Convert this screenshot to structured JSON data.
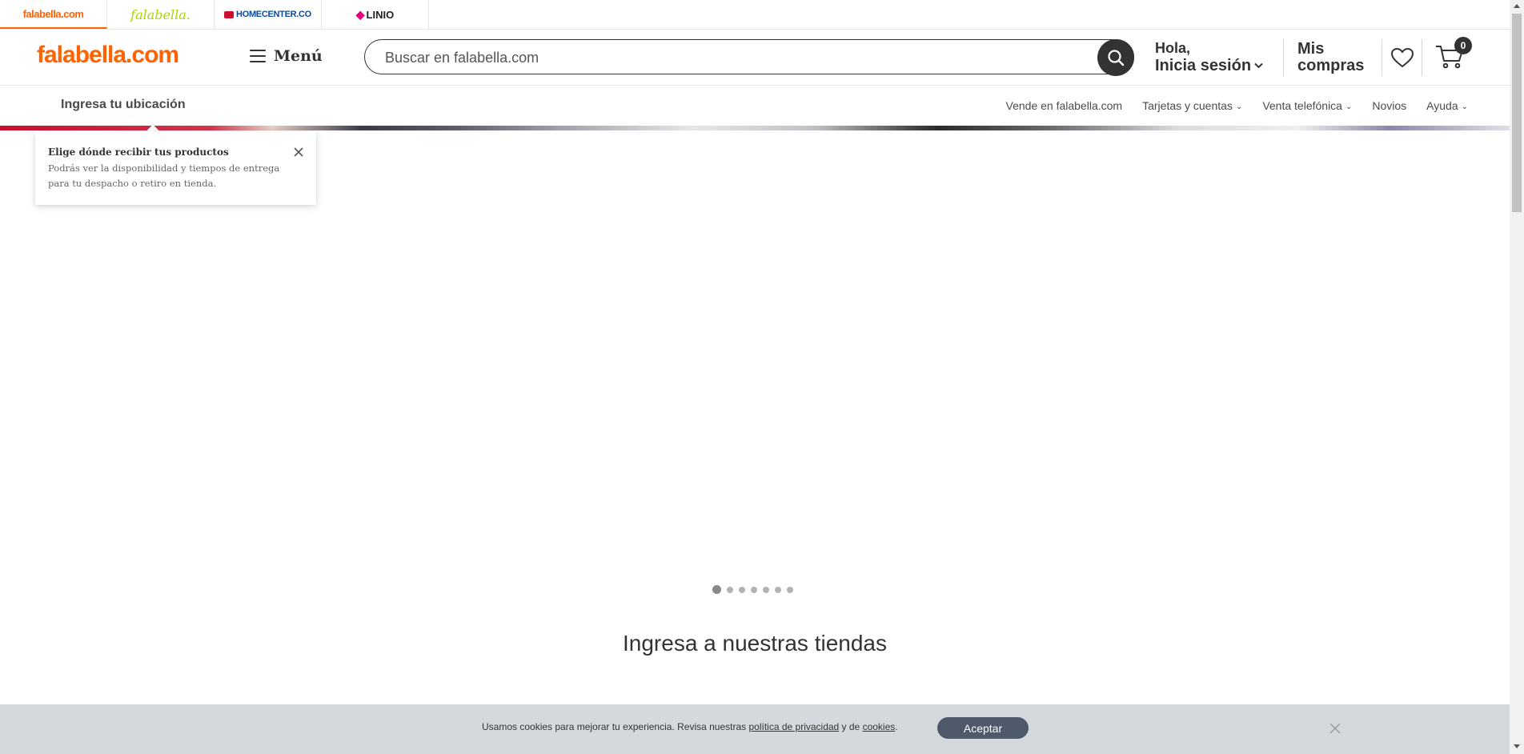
{
  "brand_tabs": [
    {
      "label": "falabella.com",
      "active": true
    },
    {
      "label": "falabella.",
      "active": false
    },
    {
      "label": "HOMECENTER.CO",
      "active": false
    },
    {
      "label": "LINIO",
      "active": false
    }
  ],
  "header": {
    "logo": "falabella.com",
    "menu_label": "Menú",
    "search_placeholder": "Buscar en falabella.com",
    "greeting": "Hola,",
    "login_label": "Inicia sesión",
    "orders_line1": "Mis",
    "orders_line2": "compras",
    "cart_count": "0",
    "accent_color": "#ff6200",
    "icons": [
      "hamburger-icon",
      "search-icon",
      "chevron-down-icon",
      "heart-icon",
      "cart-icon"
    ]
  },
  "subnav": {
    "location_label": "Ingresa tu ubicación",
    "links": [
      {
        "label": "Vende en falabella.com",
        "dropdown": false
      },
      {
        "label": "Tarjetas y cuentas",
        "dropdown": true
      },
      {
        "label": "Venta telefónica",
        "dropdown": true
      },
      {
        "label": "Novios",
        "dropdown": false
      },
      {
        "label": "Ayuda",
        "dropdown": true
      }
    ]
  },
  "tooltip": {
    "title": "Elige dónde recibir tus productos",
    "body": "Podrás ver la disponibilidad y tiempos de entrega para tu despacho o retiro en tienda."
  },
  "carousel": {
    "slide_count": 7,
    "active_index": 0
  },
  "main": {
    "section_title": "Ingresa a nuestras tiendas"
  },
  "cookie_bar": {
    "text_before": "Usamos cookies para mejorar tu experiencia. Revisa nuestras ",
    "privacy_link": "política de privacidad",
    "text_middle": " y de ",
    "cookies_link": "cookies",
    "text_after": ".",
    "accept_label": "Aceptar"
  }
}
